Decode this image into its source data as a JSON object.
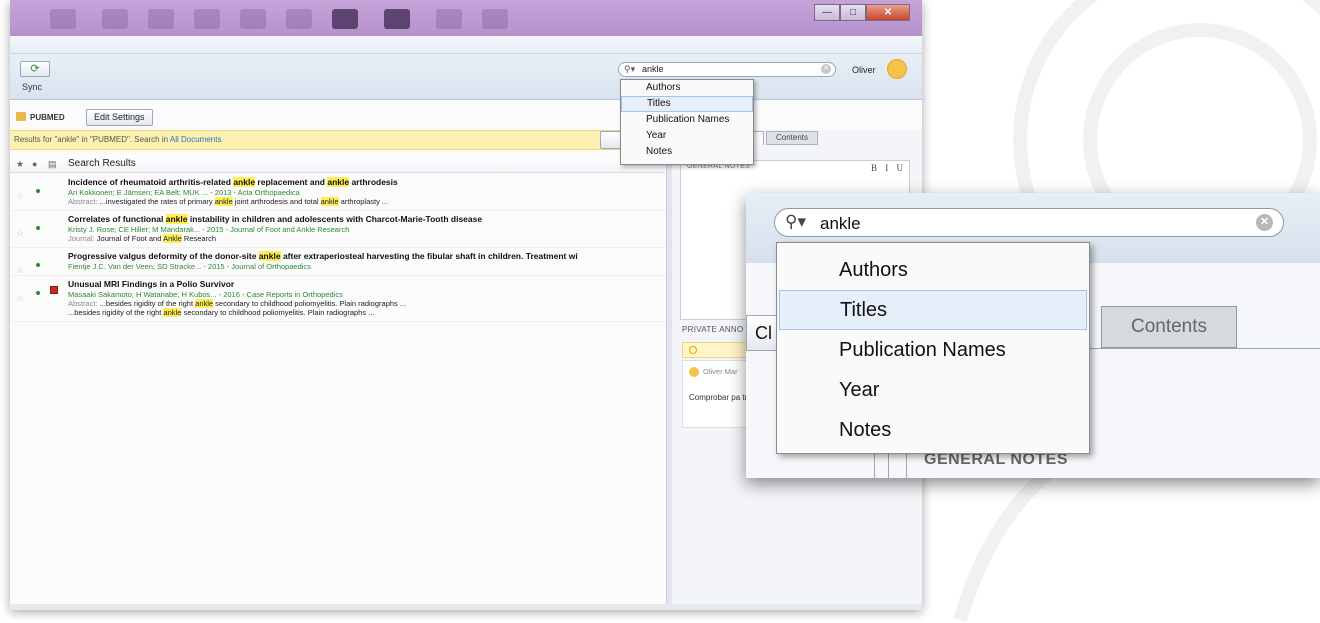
{
  "toolbar": {
    "sync_label": "Sync"
  },
  "search": {
    "query": "ankle",
    "user": "Oliver"
  },
  "search_menu": {
    "items": [
      "Authors",
      "Titles",
      "Publication Names",
      "Year",
      "Notes"
    ],
    "selected_index": 1
  },
  "library": {
    "name": "PUBMED",
    "edit_settings_label": "Edit Settings"
  },
  "results_bar": {
    "text": "Results for \"ankle\" in \"PUBMED\". Search in ",
    "link": "All Documents",
    "clear_label": "Cl"
  },
  "list": {
    "header": "Search Results"
  },
  "results": [
    {
      "title_parts": [
        "Incidence of rheumatoid arthritis-related ",
        "ankle",
        " replacement and ",
        "ankle",
        " arthrodesis"
      ],
      "authors": "Ari Kokkonen; E Jämsen; EA Belt; MUK ... - 2013 - Acta Orthopaedica",
      "line_label": "Abstract:",
      "line_parts": [
        " ...investigated the rates of primary ",
        "ankle",
        " joint arthrodesis and total ",
        "ankle",
        " arthroplasty ..."
      ],
      "extra_parts": []
    },
    {
      "title_parts": [
        "Correlates of functional ",
        "ankle",
        " instability in children and adolescents with Charcot-Marie-Tooth disease"
      ],
      "authors": "Kristy J. Rose; CE Hiller; M Mandarak... - 2015 - Journal of Foot and Ankle Research",
      "line_label": "Journal:",
      "line_parts": [
        " Journal of Foot and ",
        "Ankle",
        " Research"
      ],
      "extra_parts": []
    },
    {
      "title_parts": [
        "Progressive valgus deformity of the donor-site ",
        "ankle",
        " after extraperiosteal harvesting the fibular shaft in children. Treatment wi"
      ],
      "authors": "Fientje J.C. Van der Veen; SD Stracke... - 2015 - Journal of Orthopaedics",
      "line_label": "",
      "line_parts": [],
      "extra_parts": []
    },
    {
      "title_parts": [
        "Unusual MRI Findings in a Polio Survivor"
      ],
      "authors": "Masaaki Sakamoto; H Watanabe; H Kubos... - 2016 - Case Reports in Orthopedics",
      "line_label": "Abstract:",
      "line_parts": [
        " ...besides rigidity of the right ",
        "ankle",
        " secondary to childhood poliomyelitis. Plain radiographs ..."
      ],
      "extra_parts": [
        "...besides rigidity of the right ",
        "ankle",
        " secondary to childhood poliomyelitis. Plain radiographs ..."
      ]
    }
  ],
  "details": {
    "contents_tab": "Contents",
    "general_notes": "GENERAL NOTES",
    "format": [
      "B",
      "I",
      "U"
    ],
    "private_annotations": "PRIVATE ANNO",
    "annotation_user": "Oliver Mar",
    "annotation_text": "Comprobar pa trabajo"
  },
  "zoom": {
    "query": "ankle",
    "clear_label": "Cl",
    "contents_tab": "Contents",
    "general_notes": "GENERAL NOTES"
  }
}
